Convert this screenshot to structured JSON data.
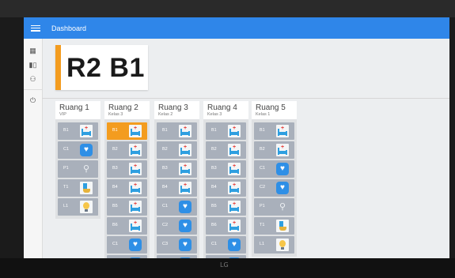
{
  "app": {
    "title": "Dashboard"
  },
  "header": {
    "label": "R2 B1"
  },
  "tv": {
    "brand": "LG"
  },
  "rooms": [
    {
      "name": "Ruang 1",
      "kelas": "VIP",
      "items": [
        {
          "code": "B1",
          "icon": "bed-icon"
        },
        {
          "code": "C1",
          "icon": "heart-icon"
        },
        {
          "code": "P1",
          "icon": "tap-icon"
        },
        {
          "code": "T1",
          "icon": "toilet-icon"
        },
        {
          "code": "L1",
          "icon": "lightbulb-icon"
        }
      ]
    },
    {
      "name": "Ruang 2",
      "kelas": "Kelas 3",
      "items": [
        {
          "code": "B1",
          "icon": "bed-icon",
          "active": true
        },
        {
          "code": "B2",
          "icon": "bed-icon"
        },
        {
          "code": "B3",
          "icon": "bed-icon"
        },
        {
          "code": "B4",
          "icon": "bed-icon"
        },
        {
          "code": "B5",
          "icon": "bed-icon"
        },
        {
          "code": "B6",
          "icon": "bed-icon"
        },
        {
          "code": "C1",
          "icon": "heart-icon"
        },
        {
          "code": "C2",
          "icon": "heart-icon"
        }
      ]
    },
    {
      "name": "Ruang 3",
      "kelas": "Kelas 2",
      "items": [
        {
          "code": "B1",
          "icon": "bed-icon"
        },
        {
          "code": "B2",
          "icon": "bed-icon"
        },
        {
          "code": "B3",
          "icon": "bed-icon"
        },
        {
          "code": "B4",
          "icon": "bed-icon"
        },
        {
          "code": "C1",
          "icon": "heart-icon"
        },
        {
          "code": "C2",
          "icon": "heart-icon"
        },
        {
          "code": "C3",
          "icon": "heart-icon"
        },
        {
          "code": "C4",
          "icon": "heart-icon"
        }
      ]
    },
    {
      "name": "Ruang 4",
      "kelas": "Kelas 3",
      "items": [
        {
          "code": "B1",
          "icon": "bed-icon"
        },
        {
          "code": "B2",
          "icon": "bed-icon"
        },
        {
          "code": "B3",
          "icon": "bed-icon"
        },
        {
          "code": "B4",
          "icon": "bed-icon"
        },
        {
          "code": "B5",
          "icon": "bed-icon"
        },
        {
          "code": "B6",
          "icon": "bed-icon"
        },
        {
          "code": "C1",
          "icon": "heart-icon"
        },
        {
          "code": "C2",
          "icon": "heart-icon"
        }
      ]
    },
    {
      "name": "Ruang 5",
      "kelas": "Kelas 1",
      "items": [
        {
          "code": "B1",
          "icon": "bed-icon"
        },
        {
          "code": "B2",
          "icon": "bed-icon"
        },
        {
          "code": "C1",
          "icon": "heart-icon"
        },
        {
          "code": "C2",
          "icon": "heart-icon"
        },
        {
          "code": "P1",
          "icon": "tap-icon"
        },
        {
          "code": "T1",
          "icon": "toilet-icon"
        },
        {
          "code": "L1",
          "icon": "lightbulb-icon"
        }
      ]
    }
  ],
  "colors": {
    "appbar": "#2f86e9",
    "accent": "#f39c1f",
    "cell": "#a9b0bb",
    "icon_blue": "#2e8fe6"
  }
}
